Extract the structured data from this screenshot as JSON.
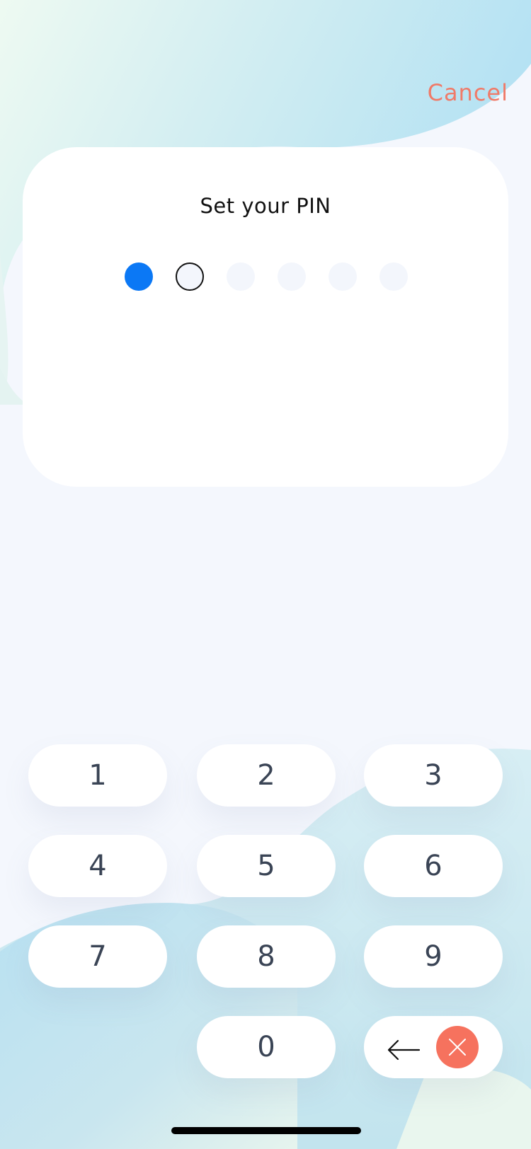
{
  "header": {
    "cancel_label": "Cancel"
  },
  "card": {
    "title": "Set your PIN",
    "pin_length": 6,
    "digits_entered": 1
  },
  "keypad": {
    "keys": [
      "1",
      "2",
      "3",
      "4",
      "5",
      "6",
      "7",
      "8",
      "9",
      "0"
    ],
    "backspace_icon": "arrow-left-icon",
    "clear_icon": "close-icon"
  },
  "colors": {
    "accent": "#0b78f5",
    "cancel": "#f07a68",
    "clear_button": "#f6725e",
    "key_text": "#3a4455"
  }
}
